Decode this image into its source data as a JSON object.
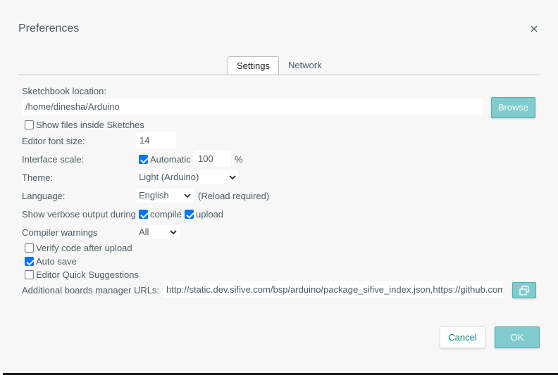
{
  "dialog": {
    "title": "Preferences",
    "close_icon": "close-icon"
  },
  "tabs": [
    {
      "label": "Settings",
      "active": true
    },
    {
      "label": "Network",
      "active": false
    }
  ],
  "settings": {
    "sketchbook_label": "Sketchbook location:",
    "sketchbook_value": "/home/dinesha/Arduino",
    "browse_label": "Browse",
    "show_files_label": "Show files inside Sketches",
    "show_files_checked": false,
    "font_size_label": "Editor font size:",
    "font_size_value": "14",
    "interface_scale_label": "Interface scale:",
    "automatic_label": "Automatic",
    "automatic_checked": true,
    "scale_value": "100",
    "scale_unit": "%",
    "theme_label": "Theme:",
    "theme_value": "Light (Arduino)",
    "language_label": "Language:",
    "language_value": "English",
    "reload_note": "(Reload required)",
    "verbose_label": "Show verbose output during",
    "compile_label": "compile",
    "compile_checked": true,
    "upload_label": "upload",
    "upload_checked": true,
    "warnings_label": "Compiler warnings",
    "warnings_value": "All",
    "verify_label": "Verify code after upload",
    "verify_checked": false,
    "autosave_label": "Auto save",
    "autosave_checked": true,
    "quick_suggestions_label": "Editor Quick Suggestions",
    "quick_suggestions_checked": false,
    "boards_url_label": "Additional boards manager URLs:",
    "boards_url_value": "http://static.dev.sifive.com/bsp/arduino/package_sifive_index.json,https://github.com/",
    "boards_url_button_icon": "open-window-icon"
  },
  "footer": {
    "cancel_label": "Cancel",
    "ok_label": "OK"
  },
  "colors": {
    "accent": "#7fcbcd",
    "link": "#008184",
    "checkbox": "#0075ff"
  }
}
